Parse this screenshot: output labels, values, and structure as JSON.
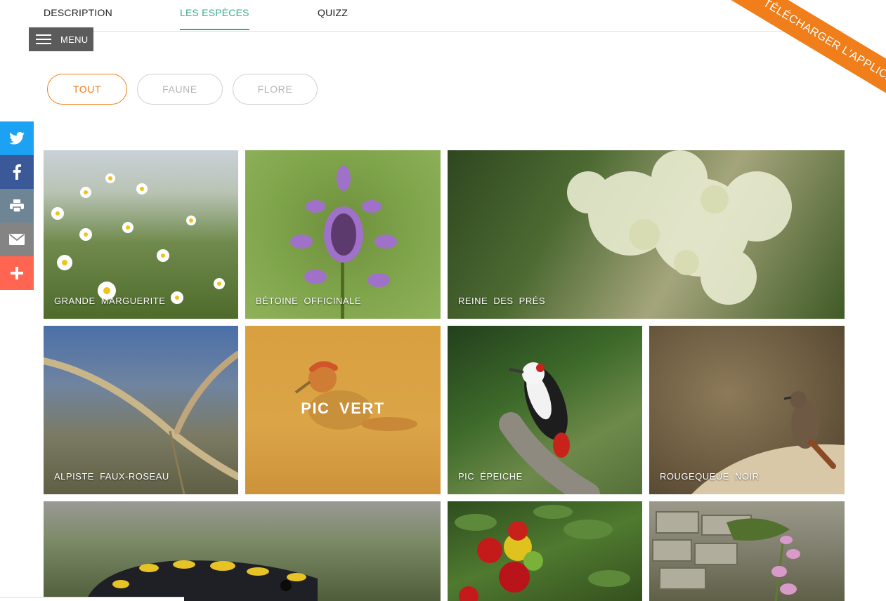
{
  "tabs": [
    {
      "label": "DESCRIPTION",
      "active": false
    },
    {
      "label": "LES ESPÈCES",
      "active": true
    },
    {
      "label": "QUIZZ",
      "active": false
    }
  ],
  "menu": {
    "label": "MENU"
  },
  "ribbon": {
    "label": "TÉLÉCHARGER L'APPLICATION"
  },
  "filters": [
    {
      "label": "TOUT",
      "active": true
    },
    {
      "label": "FAUNE",
      "active": false
    },
    {
      "label": "FLORE",
      "active": false
    }
  ],
  "social": [
    "twitter-icon",
    "facebook-icon",
    "print-icon",
    "email-icon",
    "plus-icon"
  ],
  "species": [
    {
      "name": "GRANDE MARGUERITE"
    },
    {
      "name": "BÉTOINE OFFICINALE"
    },
    {
      "name": "REINE DES PRÉS"
    },
    {
      "name": "ALPISTE FAUX-ROSEAU"
    },
    {
      "name": "PIC VERT"
    },
    {
      "name": "PIC ÉPEICHE"
    },
    {
      "name": "ROUGEQUEUE NOIR"
    },
    {
      "name": ""
    },
    {
      "name": ""
    },
    {
      "name": ""
    }
  ],
  "colors": {
    "accent_green": "#3aab8c",
    "accent_orange": "#f07e1a",
    "twitter": "#1da1f2",
    "facebook": "#3b5998",
    "print": "#6d8595",
    "email": "#848484",
    "more": "#ff6550"
  }
}
